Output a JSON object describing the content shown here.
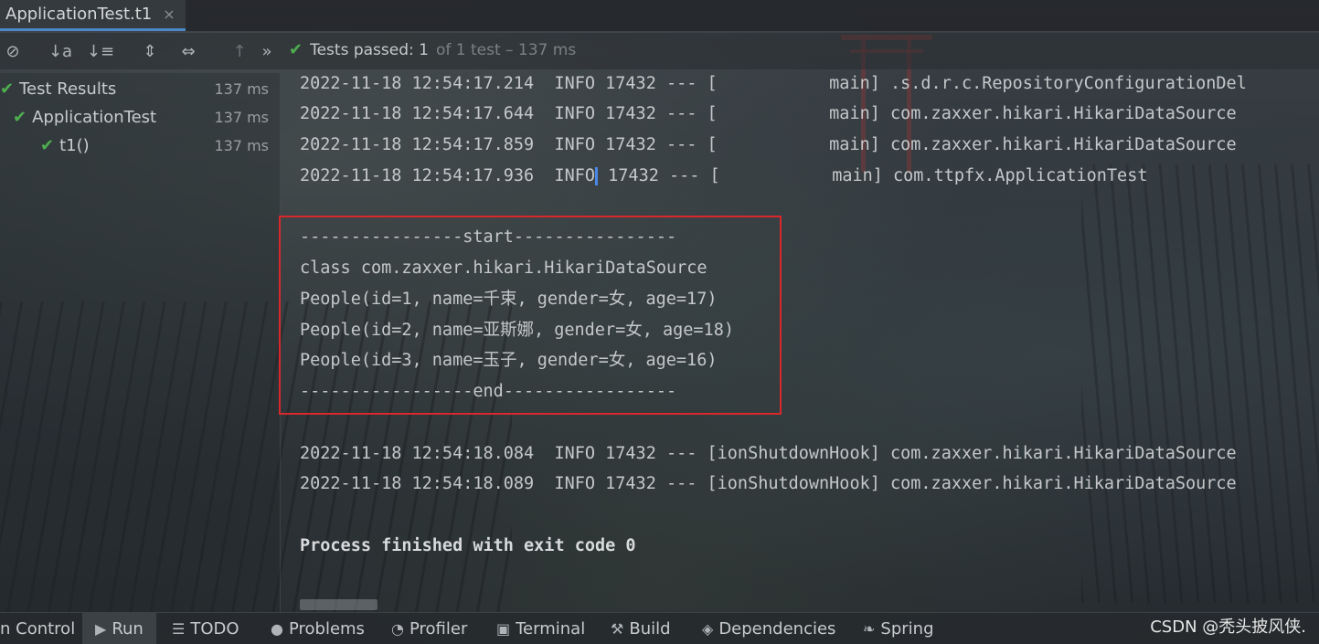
{
  "tab": {
    "title": "ApplicationTest.t1",
    "close": "×"
  },
  "toolbar": {
    "stop_icon": "⊘",
    "sort_alpha_icon": "↓a",
    "sort_duration_icon": "↓≡",
    "expand_icon": "⇕",
    "collapse_icon": "⇔",
    "up_icon": "↑",
    "more_icon": "»",
    "status": {
      "check": "✔",
      "passed_text": "Tests passed: 1",
      "detail": "of 1 test – 137 ms"
    }
  },
  "tree": {
    "items": [
      {
        "label": "Test Results",
        "time": "137 ms"
      },
      {
        "label": "ApplicationTest",
        "time": "137 ms"
      },
      {
        "label": "t1()",
        "time": "137 ms"
      }
    ],
    "check": "✔"
  },
  "console": {
    "lines": [
      "2022-11-18 12:54:17.214  INFO 17432 --- [           main] .s.d.r.c.RepositoryConfigurationDel",
      "2022-11-18 12:54:17.644  INFO 17432 --- [           main] com.zaxxer.hikari.HikariDataSource",
      "2022-11-18 12:54:17.859  INFO 17432 --- [           main] com.zaxxer.hikari.HikariDataSource",
      "2022-11-18 12:54:17.936  INFO",
      " 17432 --- [           main] com.ttpfx.ApplicationTest",
      "----------------start----------------",
      "class com.zaxxer.hikari.HikariDataSource",
      "People(id=1, name=千束, gender=女, age=17)",
      "People(id=2, name=亚斯娜, gender=女, age=18)",
      "People(id=3, name=玉子, gender=女, age=16)",
      "-----------------end-----------------",
      "2022-11-18 12:54:18.084  INFO 17432 --- [ionShutdownHook] com.zaxxer.hikari.HikariDataSource",
      "2022-11-18 12:54:18.089  INFO 17432 --- [ionShutdownHook] com.zaxxer.hikari.HikariDataSource",
      "Process finished with exit code 0"
    ]
  },
  "bottombar": {
    "items": [
      {
        "icon": "",
        "label": "n Control"
      },
      {
        "icon": "▶",
        "label": "Run"
      },
      {
        "icon": "☰",
        "label": "TODO"
      },
      {
        "icon": "●",
        "label": "Problems"
      },
      {
        "icon": "◔",
        "label": "Profiler"
      },
      {
        "icon": "▣",
        "label": "Terminal"
      },
      {
        "icon": "⚒",
        "label": "Build"
      },
      {
        "icon": "◈",
        "label": "Dependencies"
      },
      {
        "icon": "❧",
        "label": "Spring"
      }
    ],
    "watermark": "CSDN @秃头披风侠."
  },
  "colors": {
    "accent": "#4a88c7",
    "pass": "#4fae4f",
    "highlight_border": "#d9282c"
  }
}
